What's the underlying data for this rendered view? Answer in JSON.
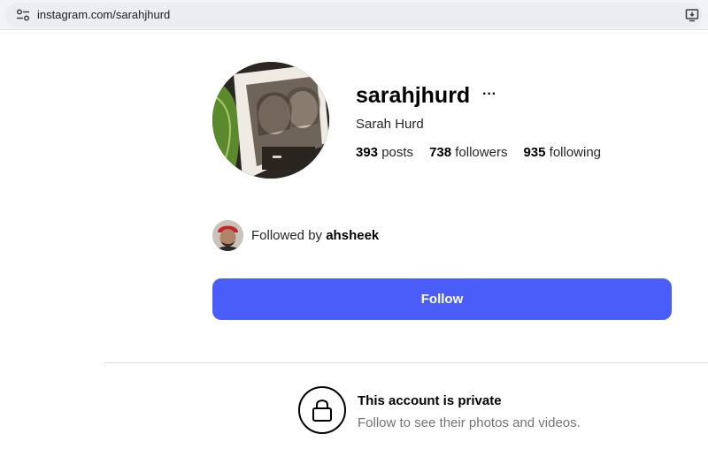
{
  "browser": {
    "url": "instagram.com/sarahjhurd"
  },
  "profile": {
    "username": "sarahjhurd",
    "more_glyph": "···",
    "full_name": "Sarah Hurd",
    "stats": [
      {
        "count": "393",
        "label": " posts"
      },
      {
        "count": "738",
        "label": " followers"
      },
      {
        "count": "935",
        "label": " following"
      }
    ]
  },
  "followed_by": {
    "prefix": "Followed by ",
    "name": "ahsheek"
  },
  "follow_button": {
    "label": "Follow",
    "color": "#4a5df9"
  },
  "private_notice": {
    "title": "This account is private",
    "subtitle": "Follow to see their photos and videos."
  },
  "icons": {
    "site_info": "tune-icon",
    "install": "install-app-icon",
    "more": "more-options-icon",
    "lock": "lock-icon"
  }
}
